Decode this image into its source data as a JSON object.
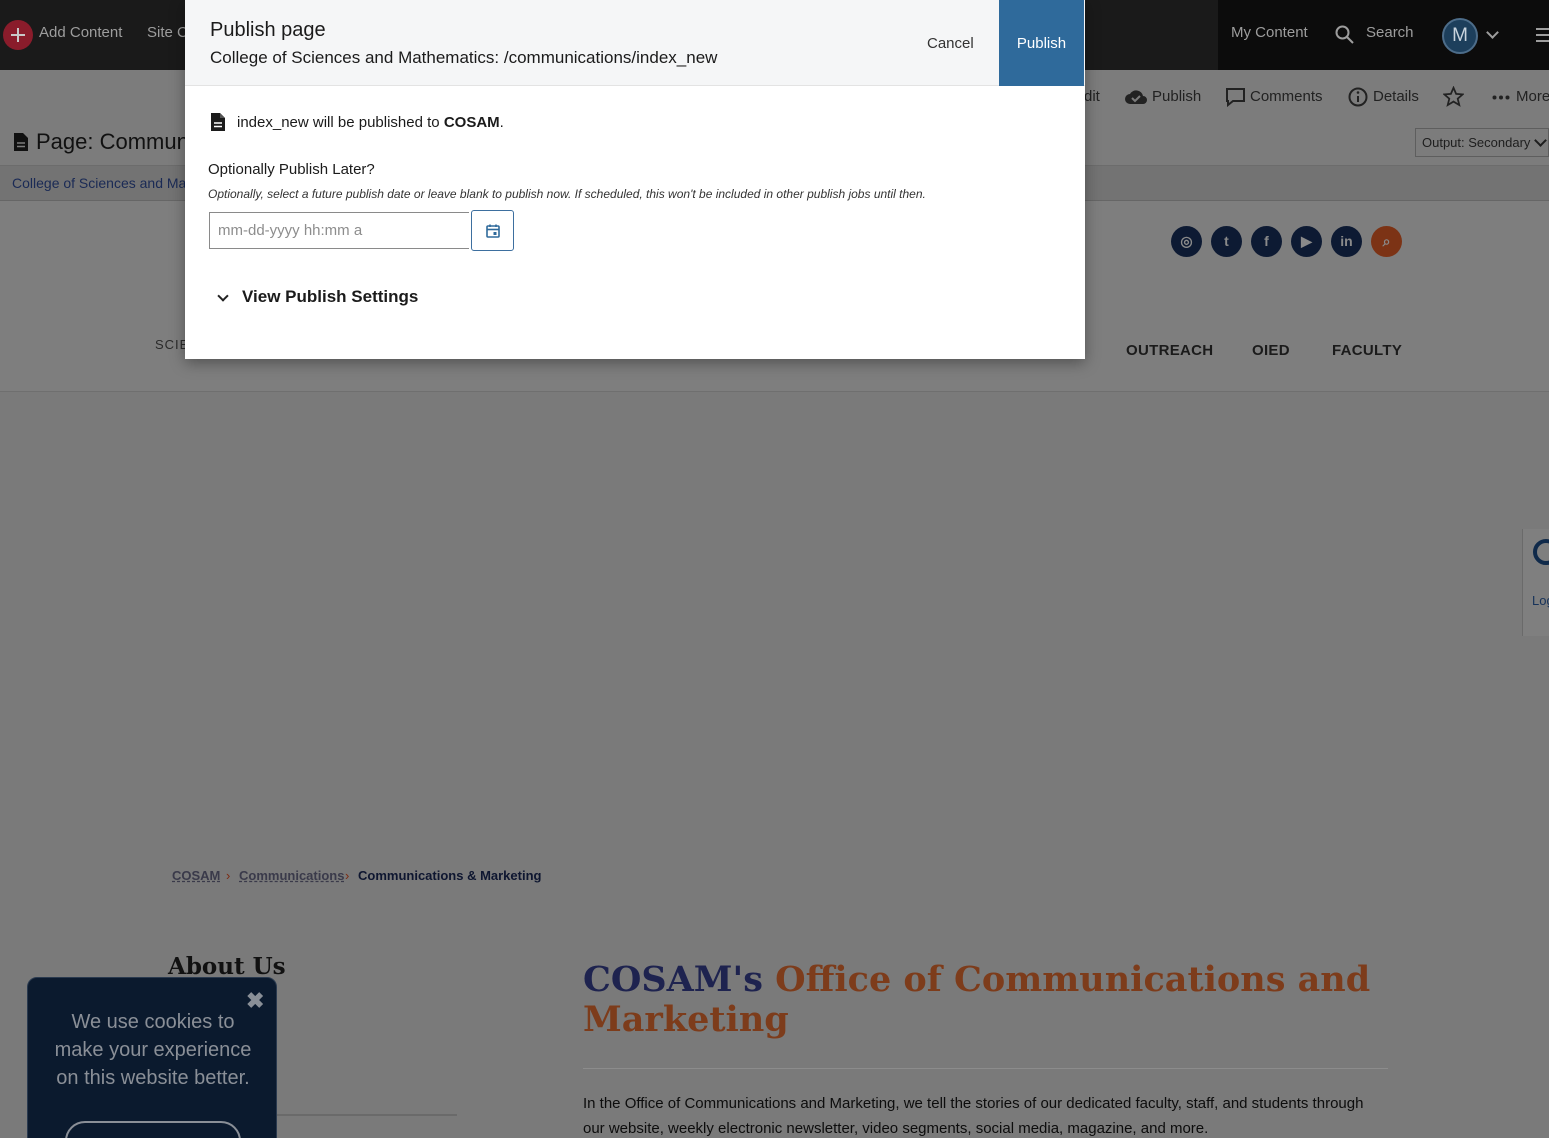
{
  "topbar": {
    "add_content": "Add Content",
    "site_partial": "Site C",
    "my_content": "My Content",
    "search": "Search",
    "avatar_initial": "M"
  },
  "toolbar": {
    "edit_partial": "dit",
    "publish": "Publish",
    "comments": "Comments",
    "details": "Details",
    "more": "More",
    "page_title_partial": "Page: Communi",
    "output_select": "Output: Secondary",
    "breadcrumb_partial": "College of Sciences and Ma"
  },
  "site": {
    "nav_left_partial": "SCIE",
    "nav_items": [
      "OUTREACH",
      "OIED",
      "FACULTY"
    ],
    "social_icons": [
      "instagram-icon",
      "twitter-icon",
      "facebook-icon",
      "youtube-icon",
      "linkedin-icon",
      "search-icon"
    ],
    "breadcrumb": {
      "home": "COSAM",
      "section": "Communications",
      "current": "Communications & Marketing"
    },
    "sidebar_heading": "About Us",
    "heading_navy": "COSAM's",
    "heading_orange": "Office of Communications and Marketing",
    "intro": "In the Office of Communications and Marketing, we tell the stories of our dedicated faculty, staff, and students through our website, weekly electronic newsletter, video segments, social media, magazine, and more."
  },
  "cookie": {
    "text": "We use cookies to make your experience on this website better."
  },
  "right_widget": {
    "text_partial": "Log"
  },
  "modal": {
    "title": "Publish page",
    "subtitle": "College of Sciences and Mathematics: /communications/index_new",
    "cancel": "Cancel",
    "publish": "Publish",
    "info_page": "index_new",
    "info_middle": "will be published to",
    "info_dest": "COSAM",
    "info_end": ".",
    "later_label": "Optionally Publish Later?",
    "later_help": "Optionally, select a future publish date or leave blank to publish now. If scheduled, this won't be included in other publish jobs until then.",
    "date_placeholder": "mm-dd-yyyy hh:mm a",
    "date_value": "",
    "settings_toggle": "View Publish Settings"
  },
  "colors": {
    "publish_button": "#2f6a9b",
    "heading_navy": "#1e234f",
    "heading_orange": "#7d3c1b"
  }
}
